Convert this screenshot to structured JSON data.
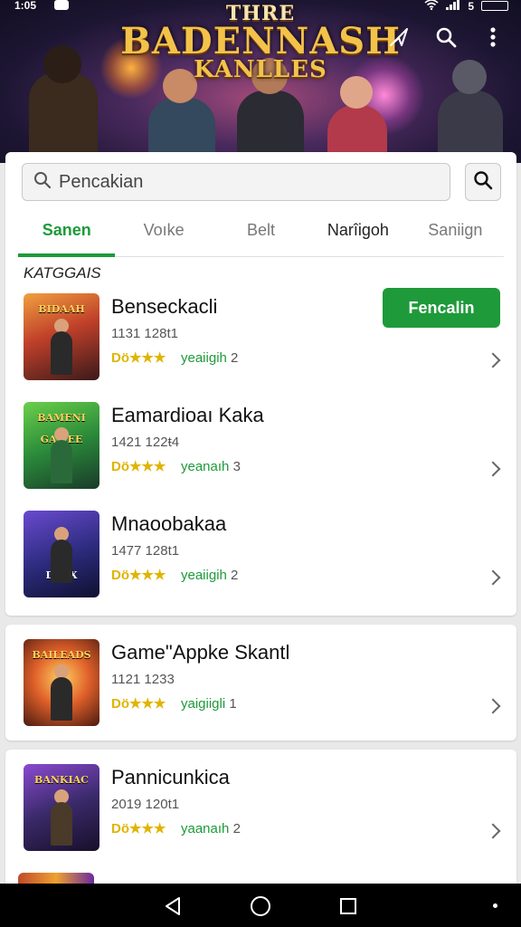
{
  "status_bar": {
    "time": "1:05",
    "battery": "5"
  },
  "banner": {
    "title_line1": "THRE",
    "title_line2": "BADENNASH",
    "title_line3": "KANLLES",
    "icons": [
      "nav-arrow-icon",
      "search-icon",
      "more-vert-icon"
    ]
  },
  "search": {
    "placeholder": "Pencakian",
    "button_icon": "search-icon"
  },
  "tabs": [
    {
      "label": "Sanen",
      "active": true
    },
    {
      "label": "Voıke",
      "active": false
    },
    {
      "label": "Belt",
      "active": false
    },
    {
      "label": "Narîigoh",
      "active": false
    },
    {
      "label": "Saniign",
      "active": false
    }
  ],
  "section_label": "KATGGAIS",
  "install_button": "Fencalin",
  "items": [
    {
      "name": "Benseckacli",
      "meta": "1131 128t1",
      "stars": "Dö★★★",
      "rating_label": "yeaiigih",
      "rating_num": "2"
    },
    {
      "name": "Eamardioaı Kaka",
      "meta": "1421 122ŧ4",
      "stars": "Dö★★★",
      "rating_label": "yeanaıh",
      "rating_num": "3"
    },
    {
      "name": "Mnaoobakaa",
      "meta": "1477 128t1",
      "stars": "Dö★★★",
      "rating_label": "yeaiigih",
      "rating_num": "2"
    },
    {
      "name": "Game\"Appke Skantl",
      "meta": "1121 1233",
      "stars": "Dö★★★",
      "rating_label": "yaigiigli",
      "rating_num": "1"
    },
    {
      "name": "Pannicunkica",
      "meta": "2019 120t1",
      "stars": "Dö★★★",
      "rating_label": "yaanaıh",
      "rating_num": "2"
    }
  ],
  "thumb_logos": [
    "BIDAAH",
    "BAMENI GAMEE",
    "DXEX",
    "BAILEADS",
    "BANKIAC"
  ],
  "colors": {
    "accent_green": "#1e9a3a",
    "star_yellow": "#e0b400"
  }
}
